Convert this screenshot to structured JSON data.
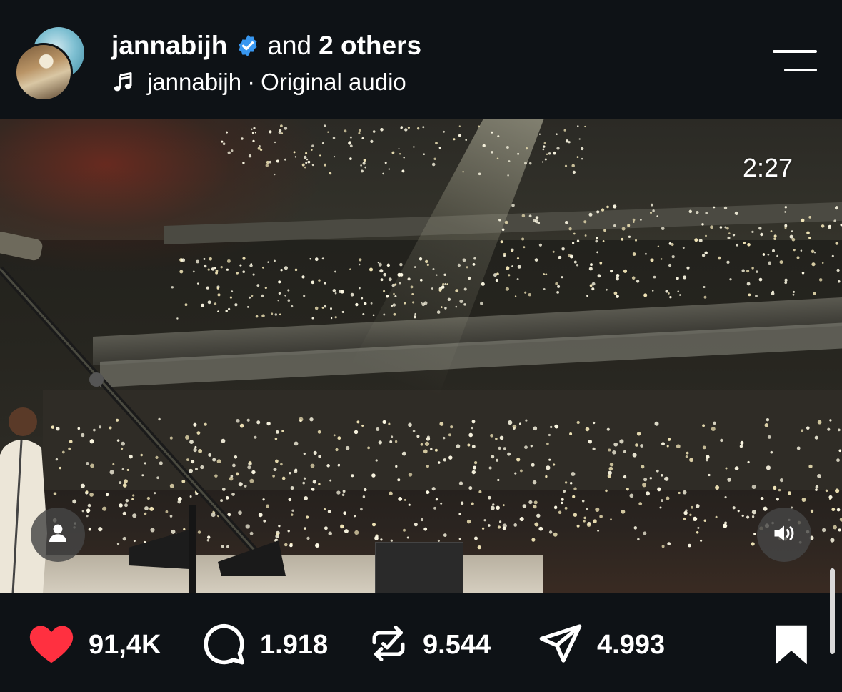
{
  "header": {
    "username": "jannabijh",
    "and_text": "and",
    "others_text": "2 others",
    "audio_author": "jannabijh",
    "audio_separator": "·",
    "audio_label": "Original audio"
  },
  "video": {
    "duration": "2:27"
  },
  "actions": {
    "likes": "91,4K",
    "comments": "1.918",
    "reposts": "9.544",
    "shares": "4.993"
  },
  "colors": {
    "background": "#0e1216",
    "like_red": "#ff3040",
    "verified_blue": "#3897f0",
    "text": "#ffffff"
  },
  "icons": {
    "like": "heart-icon",
    "comment": "comment-bubble-icon",
    "repost": "repost-icon",
    "share": "send-icon",
    "bookmark": "bookmark-icon",
    "menu": "menu-icon",
    "music": "music-note-icon",
    "tag": "person-tag-icon",
    "volume": "volume-icon",
    "verified": "verified-badge-icon"
  }
}
